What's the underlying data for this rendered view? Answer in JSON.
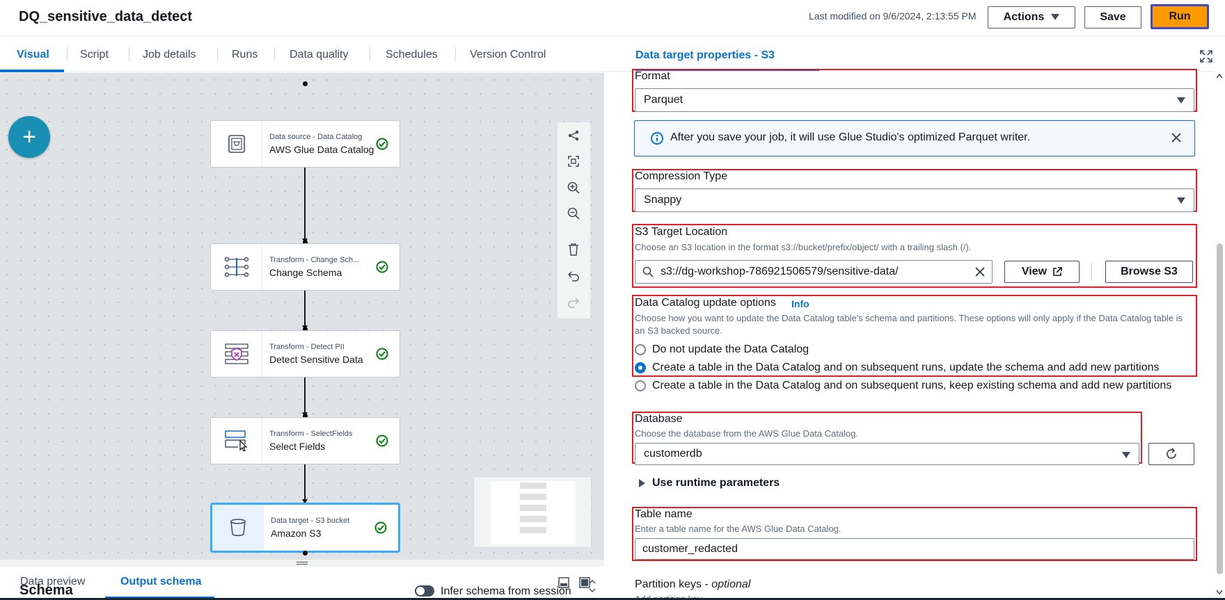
{
  "header": {
    "job_title": "DQ_sensitive_data_detect",
    "last_modified": "Last modified on 9/6/2024, 2:13:55 PM",
    "actions_label": "Actions",
    "save_label": "Save",
    "run_label": "Run"
  },
  "tabs": [
    "Visual",
    "Script",
    "Job details",
    "Runs",
    "Data quality",
    "Schedules",
    "Version Control"
  ],
  "nodes": [
    {
      "type": "Data source - Data Catalog",
      "name": "AWS Glue Data Catalog",
      "icon": "catalog-icon",
      "status": "success"
    },
    {
      "type": "Transform - Change Sch...",
      "name": "Change Schema",
      "icon": "change-schema-icon",
      "status": "success"
    },
    {
      "type": "Transform - Detect PII",
      "name": "Detect Sensitive Data",
      "icon": "detect-pii-icon",
      "status": "success"
    },
    {
      "type": "Transform - SelectFields",
      "name": "Select Fields",
      "icon": "select-fields-icon",
      "status": "success"
    },
    {
      "type": "Data target - S3 bucket",
      "name": "Amazon S3",
      "icon": "s3-bucket-icon",
      "status": "success",
      "selected": true
    }
  ],
  "add_node_label": "+",
  "bottom_panel": {
    "tabs": [
      "Data preview",
      "Output schema"
    ],
    "active_tab": "Output schema",
    "schema_title": "Schema",
    "infer_label": "Infer schema from session"
  },
  "right_panel": {
    "title": "Data target properties - S3",
    "format": {
      "label": "Format",
      "value": "Parquet"
    },
    "alert": "After you save your job, it will use Glue Studio's optimized Parquet writer.",
    "compression": {
      "label": "Compression Type",
      "value": "Snappy"
    },
    "s3_location": {
      "label": "S3 Target Location",
      "desc": "Choose an S3 location in the format s3://bucket/prefix/object/ with a trailing slash (/).",
      "value": "s3://dg-workshop-786921506579/sensitive-data/",
      "view_label": "View",
      "browse_label": "Browse S3"
    },
    "catalog_update": {
      "label": "Data Catalog update options",
      "info_label": "Info",
      "desc": "Choose how you want to update the Data Catalog table's schema and partitions. These options will only apply if the Data Catalog table is an S3 backed source.",
      "options": [
        "Do not update the Data Catalog",
        "Create a table in the Data Catalog and on subsequent runs, update the schema and add new partitions",
        "Create a table in the Data Catalog and on subsequent runs, keep existing schema and add new partitions"
      ],
      "selected_index": 1
    },
    "database": {
      "label": "Database",
      "desc": "Choose the database from the AWS Glue Data Catalog.",
      "value": "customerdb"
    },
    "runtime_params_label": "Use runtime parameters",
    "table_name": {
      "label": "Table name",
      "desc": "Enter a table name for the AWS Glue Data Catalog.",
      "value": "customer_redacted"
    },
    "partition_keys": {
      "label": "Partition keys",
      "optional": "optional",
      "hint": "Add partition key"
    }
  },
  "colors": {
    "accent": "#0972d3",
    "run": "#ff9900",
    "highlight": "#e01e26",
    "success": "#037f0c",
    "add_node": "#1a8fb4"
  }
}
